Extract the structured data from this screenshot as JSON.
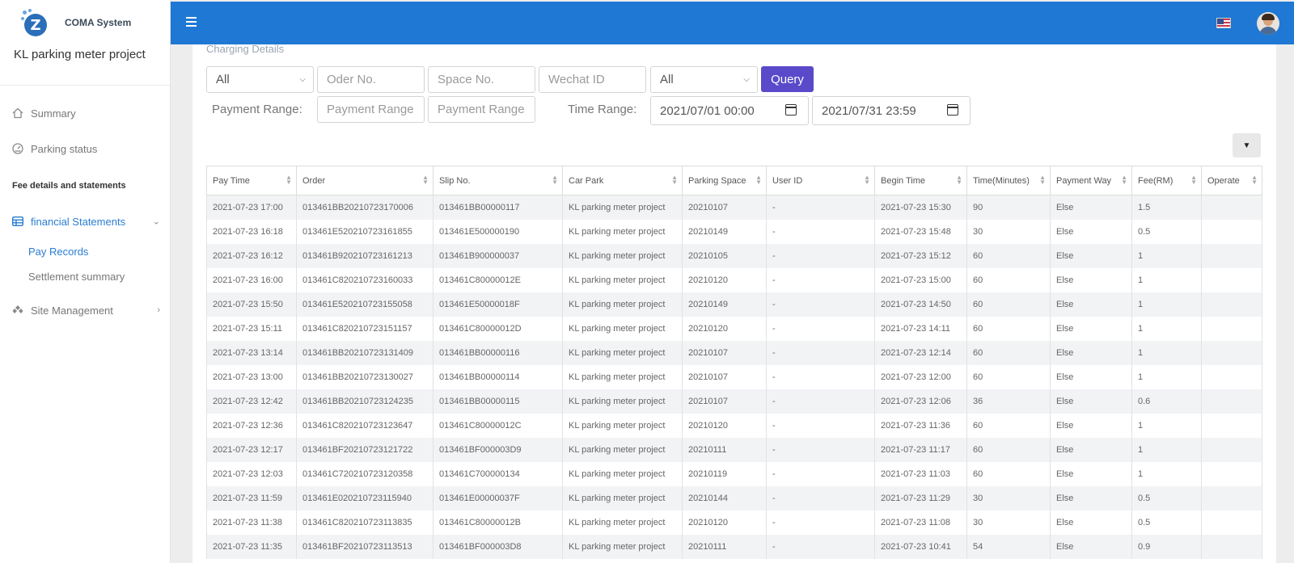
{
  "app": {
    "name": "COMA System",
    "project": "KL parking meter project"
  },
  "sidebar": {
    "items": [
      {
        "label": "Summary",
        "icon": "home-icon"
      },
      {
        "label": "Parking status",
        "icon": "gauge-icon"
      }
    ],
    "section_title": "Fee details and statements",
    "financial": {
      "label": "financial Statements",
      "icon": "table-icon"
    },
    "sub_items": [
      {
        "label": "Pay Records",
        "active": true
      },
      {
        "label": "Settlement summary",
        "active": false
      }
    ],
    "site": {
      "label": "Site Management",
      "icon": "site-icon"
    }
  },
  "topbar": {
    "menu_icon": "hamburger-icon",
    "flag": "us-flag-icon",
    "avatar": "user-avatar-icon"
  },
  "filters": {
    "section_title": "Charging Details",
    "select1_value": "All",
    "order_placeholder": "Oder No.",
    "space_placeholder": "Space No.",
    "wechat_placeholder": "Wechat ID",
    "select2_value": "All",
    "query_label": "Query",
    "payment_range_label": "Payment Range:",
    "payment_min_placeholder": "Payment Range",
    "payment_max_placeholder": "Payment Range",
    "time_range_label": "Time Range:",
    "time_start": "2021/07/01 00:00",
    "time_end": "2021/07/31 23:59"
  },
  "table": {
    "headers": [
      "Pay Time",
      "Order",
      "Slip No.",
      "Car Park",
      "Parking Space",
      "User ID",
      "Begin Time",
      "Time(Minutes)",
      "Payment Way",
      "Fee(RM)",
      "Operate"
    ],
    "rows": [
      [
        "2021-07-23 17:00",
        "013461BB20210723170006",
        "013461BB00000117",
        "KL parking meter project",
        "20210107",
        "-",
        "2021-07-23 15:30",
        "90",
        "Else",
        "1.5",
        ""
      ],
      [
        "2021-07-23 16:18",
        "013461E520210723161855",
        "013461E500000190",
        "KL parking meter project",
        "20210149",
        "-",
        "2021-07-23 15:48",
        "30",
        "Else",
        "0.5",
        ""
      ],
      [
        "2021-07-23 16:12",
        "013461B920210723161213",
        "013461B900000037",
        "KL parking meter project",
        "20210105",
        "-",
        "2021-07-23 15:12",
        "60",
        "Else",
        "1",
        ""
      ],
      [
        "2021-07-23 16:00",
        "013461C820210723160033",
        "013461C80000012E",
        "KL parking meter project",
        "20210120",
        "-",
        "2021-07-23 15:00",
        "60",
        "Else",
        "1",
        ""
      ],
      [
        "2021-07-23 15:50",
        "013461E520210723155058",
        "013461E50000018F",
        "KL parking meter project",
        "20210149",
        "-",
        "2021-07-23 14:50",
        "60",
        "Else",
        "1",
        ""
      ],
      [
        "2021-07-23 15:11",
        "013461C820210723151157",
        "013461C80000012D",
        "KL parking meter project",
        "20210120",
        "-",
        "2021-07-23 14:11",
        "60",
        "Else",
        "1",
        ""
      ],
      [
        "2021-07-23 13:14",
        "013461BB20210723131409",
        "013461BB00000116",
        "KL parking meter project",
        "20210107",
        "-",
        "2021-07-23 12:14",
        "60",
        "Else",
        "1",
        ""
      ],
      [
        "2021-07-23 13:00",
        "013461BB20210723130027",
        "013461BB00000114",
        "KL parking meter project",
        "20210107",
        "-",
        "2021-07-23 12:00",
        "60",
        "Else",
        "1",
        ""
      ],
      [
        "2021-07-23 12:42",
        "013461BB20210723124235",
        "013461BB00000115",
        "KL parking meter project",
        "20210107",
        "-",
        "2021-07-23 12:06",
        "36",
        "Else",
        "0.6",
        ""
      ],
      [
        "2021-07-23 12:36",
        "013461C820210723123647",
        "013461C80000012C",
        "KL parking meter project",
        "20210120",
        "-",
        "2021-07-23 11:36",
        "60",
        "Else",
        "1",
        ""
      ],
      [
        "2021-07-23 12:17",
        "013461BF20210723121722",
        "013461BF000003D9",
        "KL parking meter project",
        "20210111",
        "-",
        "2021-07-23 11:17",
        "60",
        "Else",
        "1",
        ""
      ],
      [
        "2021-07-23 12:03",
        "013461C720210723120358",
        "013461C700000134",
        "KL parking meter project",
        "20210119",
        "-",
        "2021-07-23 11:03",
        "60",
        "Else",
        "1",
        ""
      ],
      [
        "2021-07-23 11:59",
        "013461E020210723115940",
        "013461E00000037F",
        "KL parking meter project",
        "20210144",
        "-",
        "2021-07-23 11:29",
        "30",
        "Else",
        "0.5",
        ""
      ],
      [
        "2021-07-23 11:38",
        "013461C820210723113835",
        "013461C80000012B",
        "KL parking meter project",
        "20210120",
        "-",
        "2021-07-23 11:08",
        "30",
        "Else",
        "0.5",
        ""
      ],
      [
        "2021-07-23 11:35",
        "013461BF20210723113513",
        "013461BF000003D8",
        "KL parking meter project",
        "20210111",
        "-",
        "2021-07-23 10:41",
        "54",
        "Else",
        "0.9",
        ""
      ]
    ]
  },
  "colors": {
    "topbar": "#1e78d4",
    "accent": "#2a7dd1",
    "query_button": "#5a49c9"
  }
}
